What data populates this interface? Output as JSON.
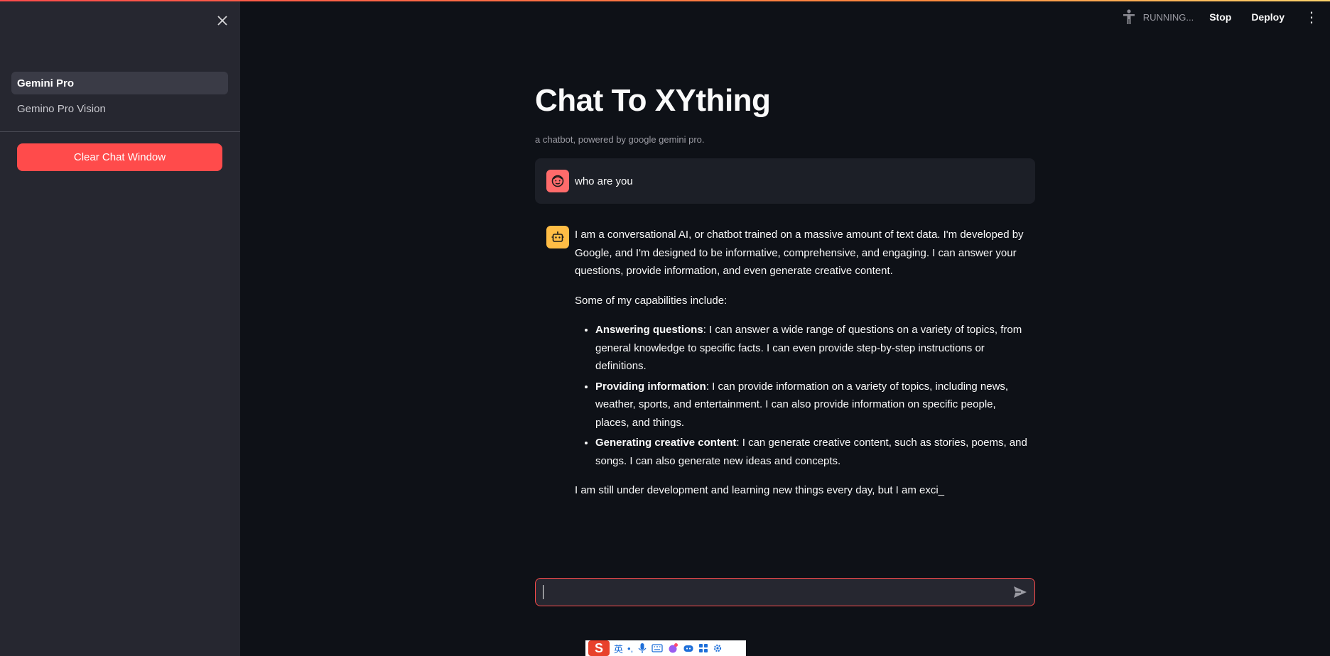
{
  "sidebar": {
    "close_label": "✕",
    "nav_items": [
      {
        "label": "Gemini Pro",
        "active": true
      },
      {
        "label": "Gemino Pro Vision",
        "active": false
      }
    ],
    "clear_button": "Clear Chat Window"
  },
  "header": {
    "status": "RUNNING...",
    "stop": "Stop",
    "deploy": "Deploy",
    "more": "⋮"
  },
  "main": {
    "title": "Chat To XYthing",
    "subtitle": "a chatbot, powered by google gemini pro.",
    "user_message": "who are you",
    "bot_message": {
      "intro": "I am a conversational AI, or chatbot trained on a massive amount of text data. I'm developed by Google, and I'm designed to be informative, comprehensive, and engaging. I can answer your questions, provide information, and even generate creative content.",
      "capabilities_heading": "Some of my capabilities include:",
      "capabilities": [
        {
          "title": "Answering questions",
          "text": ": I can answer a wide range of questions on a variety of topics, from general knowledge to specific facts. I can even provide step-by-step instructions or definitions."
        },
        {
          "title": "Providing information",
          "text": ": I can provide information on a variety of topics, including news, weather, sports, and entertainment. I can also provide information on specific people, places, and things."
        },
        {
          "title": "Generating creative content",
          "text": ": I can generate creative content, such as stories, poems, and songs. I can also generate new ideas and concepts."
        }
      ],
      "closing": "I am still under development and learning new things every day, but I am exci_"
    },
    "input_value": ""
  },
  "ime_toolbar": {
    "logo": "S",
    "lang": "英",
    "punct": "•,"
  },
  "colors": {
    "accent": "#ff4b4b",
    "sidebar_bg": "#262730",
    "main_bg": "#0e1117",
    "user_avatar": "#ff6b6b",
    "bot_avatar": "#ffbd45"
  }
}
